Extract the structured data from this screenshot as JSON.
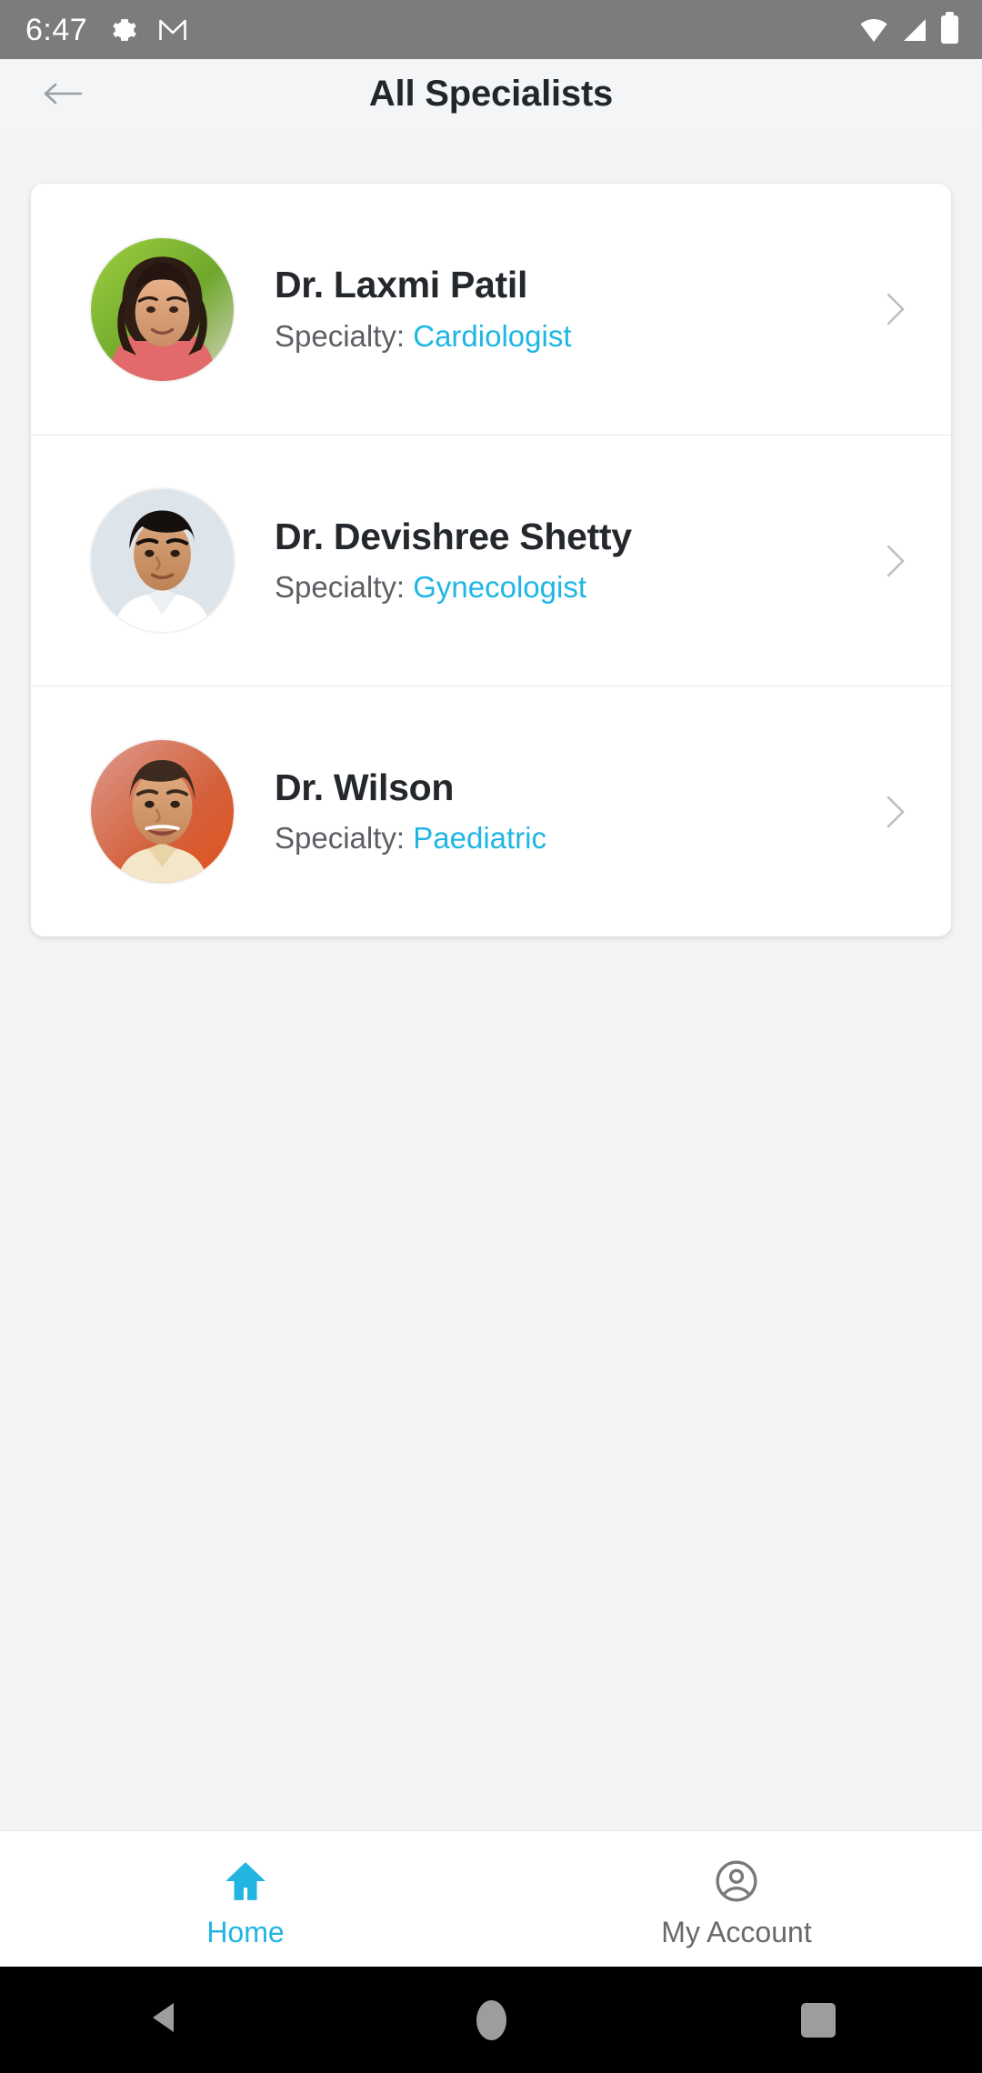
{
  "statusbar": {
    "time": "6:47",
    "left_icons": [
      "gear-icon",
      "gmail-icon"
    ],
    "right_icons": [
      "wifi-icon",
      "cell-signal-icon",
      "battery-icon"
    ],
    "background_color": "#7c7c7c",
    "foreground_color": "#ffffff"
  },
  "appbar": {
    "back_icon": "arrow-left-icon",
    "title": "All Specialists",
    "background_color": "#f4f5f7",
    "title_color": "#232629"
  },
  "theme": {
    "accent": "#1fb6e4",
    "page_background": "#f2f4f5",
    "card_background": "#ffffff",
    "muted_text": "#5b5f63"
  },
  "list": {
    "specialty_label": "Specialty:",
    "chevron_icon": "chevron-right-icon",
    "items": [
      {
        "name": "Dr. Laxmi Patil",
        "specialty_label": "Specialty:",
        "specialty": "Cardiologist",
        "avatar": "photo-female-doctor"
      },
      {
        "name": "Dr. Devishree Shetty",
        "specialty_label": "Specialty:",
        "specialty": "Gynecologist",
        "avatar": "photo-male-doctor-white-coat"
      },
      {
        "name": "Dr. Wilson",
        "specialty_label": "Specialty:",
        "specialty": "Paediatric",
        "avatar": "photo-male-doctor-smiling"
      }
    ]
  },
  "tabbar": {
    "tabs": [
      {
        "label": "Home",
        "icon": "home-icon",
        "active": true
      },
      {
        "label": "My Account",
        "icon": "account-circle-icon",
        "active": false
      }
    ]
  },
  "navbar": {
    "buttons": [
      {
        "icon": "back-triangle-icon"
      },
      {
        "icon": "home-circle-icon"
      },
      {
        "icon": "recents-square-icon"
      }
    ]
  }
}
